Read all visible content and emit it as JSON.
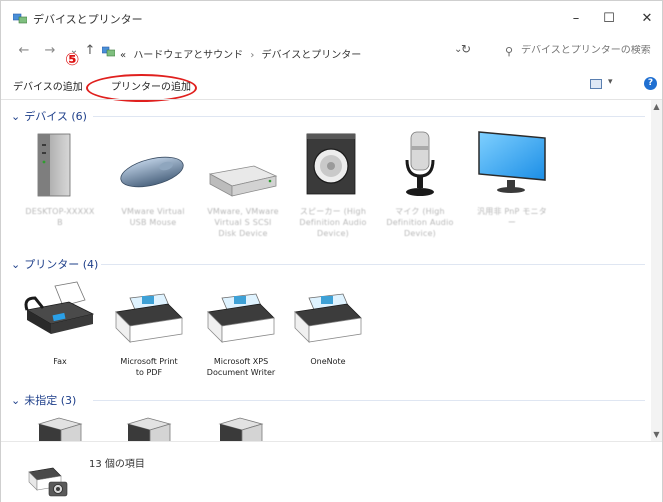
{
  "window": {
    "title": "デバイスとプリンター",
    "controls": {
      "minimize": "–",
      "maximize": "☐",
      "close": "✕"
    }
  },
  "address_bar": {
    "breadcrumbs": [
      "ハードウェアとサウンド",
      "デバイスとプリンター"
    ],
    "prefix": "«",
    "separator": "›",
    "search_placeholder": "デバイスとプリンターの検索"
  },
  "command_bar": {
    "add_device": "デバイスの追加",
    "add_printer": "プリンターの追加",
    "annotation_number": "⑤"
  },
  "groups": [
    {
      "header": "デバイス (6)",
      "items": [
        {
          "name": "computer",
          "label": "DESKTOP-XXXXX\nB",
          "blurred": true
        },
        {
          "name": "mouse",
          "label": "VMware Virtual\nUSB Mouse",
          "blurred": true
        },
        {
          "name": "usb-drive",
          "label": "VMware, VMware\nVirtual S SCSI\nDisk Device",
          "blurred": true
        },
        {
          "name": "speaker",
          "label": "スピーカー (High\nDefinition Audio\nDevice)",
          "blurred": true
        },
        {
          "name": "microphone",
          "label": "マイク (High\nDefinition Audio\nDevice)",
          "blurred": true
        },
        {
          "name": "monitor",
          "label": "汎用非 PnP モニタ\nー",
          "blurred": true
        }
      ]
    },
    {
      "header": "プリンター (4)",
      "items": [
        {
          "name": "fax",
          "label": "Fax",
          "blurred": false
        },
        {
          "name": "ms-print-pdf",
          "label": "Microsoft Print\nto PDF",
          "blurred": false
        },
        {
          "name": "ms-xps",
          "label": "Microsoft XPS\nDocument Writer",
          "blurred": false
        },
        {
          "name": "onenote",
          "label": "OneNote",
          "blurred": false
        }
      ]
    },
    {
      "header": "未指定 (3)",
      "items": [
        {
          "name": "unspecified-1",
          "label": "",
          "blurred": false
        },
        {
          "name": "unspecified-2",
          "label": "",
          "blurred": false
        },
        {
          "name": "unspecified-3",
          "label": "",
          "blurred": false
        }
      ]
    }
  ],
  "status_bar": {
    "count": "13 個の項目"
  },
  "colors": {
    "group_header": "#1e3f8a",
    "annotation": "#e0201e",
    "help": "#1f6fd1"
  }
}
